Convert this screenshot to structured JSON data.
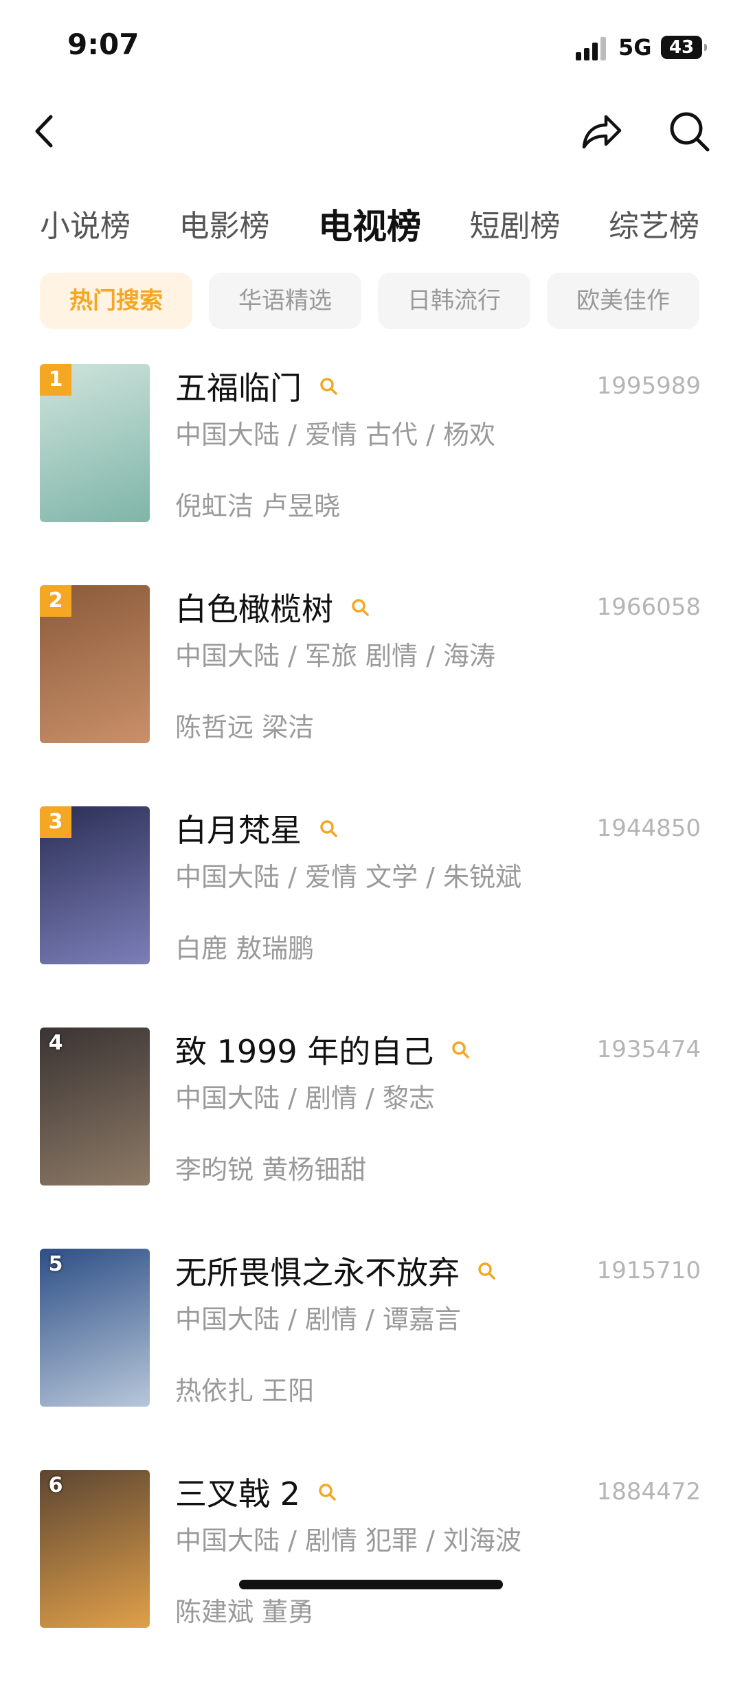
{
  "status_bar": {
    "time": "9:07",
    "network": "5G",
    "battery": "43"
  },
  "nav": {
    "back_icon": "chevron-left-icon",
    "share_icon": "share-icon",
    "search_icon": "search-icon"
  },
  "category_tabs": [
    {
      "label": "小说榜",
      "active": false
    },
    {
      "label": "电影榜",
      "active": false
    },
    {
      "label": "电视榜",
      "active": true
    },
    {
      "label": "短剧榜",
      "active": false
    },
    {
      "label": "综艺榜",
      "active": false
    }
  ],
  "filter_chips": [
    {
      "label": "热门搜索",
      "active": true
    },
    {
      "label": "华语精选",
      "active": false
    },
    {
      "label": "日韩流行",
      "active": false
    },
    {
      "label": "欧美佳作",
      "active": false
    }
  ],
  "colors": {
    "accent": "#f5a623",
    "chip_active_bg": "#fff3e3"
  },
  "items": [
    {
      "rank": "1",
      "title": "五福临门",
      "score": "1995989",
      "meta": "中国大陆 / 爱情 古代 / 杨欢",
      "cast": "倪虹洁 卢昱晓",
      "poster_colors": [
        "#cfe3dc",
        "#7fb5a7"
      ]
    },
    {
      "rank": "2",
      "title": "白色橄榄树",
      "score": "1966058",
      "meta": "中国大陆 / 军旅 剧情 / 海涛",
      "cast": "陈哲远 梁洁",
      "poster_colors": [
        "#8a5a3a",
        "#c9906a"
      ]
    },
    {
      "rank": "3",
      "title": "白月梵星",
      "score": "1944850",
      "meta": "中国大陆 / 爱情 文学 / 朱锐斌",
      "cast": "白鹿 敖瑞鹏",
      "poster_colors": [
        "#2b2f55",
        "#7c7fb8"
      ]
    },
    {
      "rank": "4",
      "title": "致 1999 年的自己",
      "score": "1935474",
      "meta": "中国大陆 / 剧情 / 黎志",
      "cast": "李昀锐 黄杨钿甜",
      "poster_colors": [
        "#3a3434",
        "#8d7a66"
      ]
    },
    {
      "rank": "5",
      "title": "无所畏惧之永不放弃",
      "score": "1915710",
      "meta": "中国大陆 / 剧情 / 谭嘉言",
      "cast": "热依扎 王阳",
      "poster_colors": [
        "#2e4f86",
        "#b8c7d9"
      ]
    },
    {
      "rank": "6",
      "title": "三叉戟 2",
      "score": "1884472",
      "meta": "中国大陆 / 剧情 犯罪 / 刘海波",
      "cast": "陈建斌 董勇",
      "poster_colors": [
        "#5c4632",
        "#e0a04a"
      ]
    }
  ]
}
